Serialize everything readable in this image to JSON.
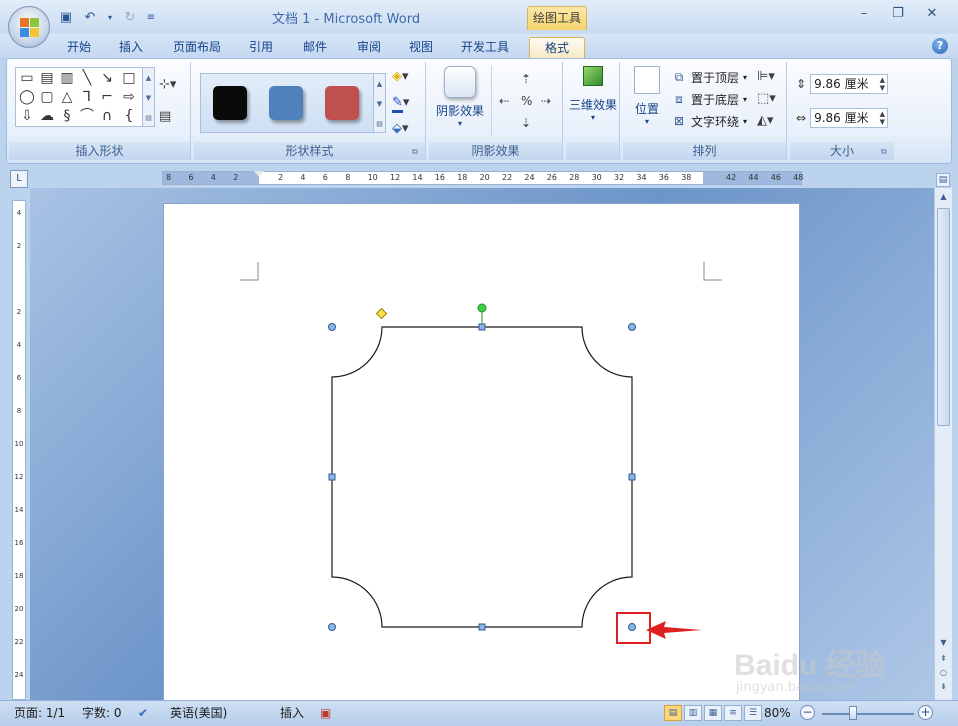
{
  "window": {
    "title": "文档 1 - Microsoft Word",
    "context_tab": "绘图工具",
    "controls": [
      "–",
      "❐",
      "✕"
    ]
  },
  "quick_access": [
    {
      "icon": "save-icon",
      "glyph": "💾"
    },
    {
      "icon": "undo-icon",
      "glyph": "↶"
    },
    {
      "icon": "redo-icon",
      "glyph": "↷"
    },
    {
      "icon": "customize-icon",
      "glyph": "▾"
    }
  ],
  "tabs": [
    "开始",
    "插入",
    "页面布局",
    "引用",
    "邮件",
    "审阅",
    "视图",
    "开发工具",
    "格式"
  ],
  "active_tab": "格式",
  "ribbon": {
    "insert_shapes": {
      "label": "插入形状"
    },
    "shape_styles": {
      "label": "形状样式",
      "swatches": [
        "#0a0a0a",
        "#4f81bd",
        "#c0504d"
      ]
    },
    "shadow": {
      "label": "阴影效果",
      "button": "阴影效果"
    },
    "effects3d": {
      "button": "三维效果"
    },
    "arrange": {
      "label": "排列",
      "position": "位置",
      "bring_front": "置于顶层",
      "send_back": "置于底层",
      "text_wrap": "文字环绕"
    },
    "size": {
      "label": "大小",
      "height": "9.86 厘米",
      "width": "9.86 厘米"
    }
  },
  "ruler": {
    "h_numbers": [
      "8",
      "6",
      "4",
      "2",
      "",
      "2",
      "4",
      "6",
      "8",
      "10",
      "12",
      "14",
      "16",
      "18",
      "20",
      "22",
      "24",
      "26",
      "28",
      "30",
      "32",
      "34",
      "36",
      "38",
      "",
      "42",
      "44",
      "46",
      "48"
    ],
    "v_numbers": [
      "4",
      "2",
      "",
      "2",
      "4",
      "6",
      "8",
      "10",
      "12",
      "14",
      "16",
      "18",
      "20",
      "22",
      "24"
    ]
  },
  "status": {
    "page": "页面: 1/1",
    "words": "字数: 0",
    "language": "英语(美国)",
    "mode": "插入",
    "zoom": "80%"
  },
  "watermark": {
    "text": "Baidu 经验",
    "sub": "jingyan.baidu.com"
  }
}
